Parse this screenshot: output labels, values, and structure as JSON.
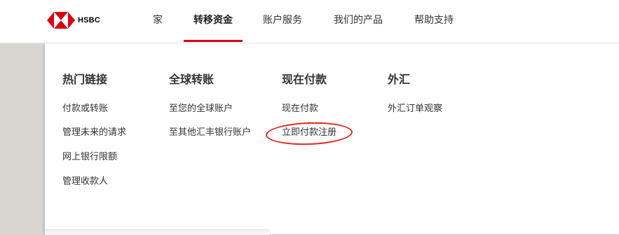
{
  "brand": {
    "name": "HSBC",
    "logo_icon": "hsbc-hexagon-logo",
    "accent": "#db0011"
  },
  "nav": {
    "items": [
      {
        "label": "家"
      },
      {
        "label": "转移资金",
        "active": true
      },
      {
        "label": "账户服务"
      },
      {
        "label": "我们的产品"
      },
      {
        "label": "帮助支持"
      }
    ]
  },
  "menu": {
    "columns": [
      {
        "heading": "热门链接",
        "links": [
          "付款或转账",
          "管理未来的请求",
          "网上银行限额",
          "管理收款人"
        ]
      },
      {
        "heading": "全球转账",
        "links": [
          "至您的全球账户",
          "至其他汇丰银行账户"
        ]
      },
      {
        "heading": "现在付款",
        "links": [
          "现在付款",
          "立即付款注册"
        ]
      },
      {
        "heading": "外汇",
        "links": [
          "外汇订单观察"
        ]
      }
    ],
    "highlighted_link": "立即付款注册",
    "highlight_color": "#e3261b"
  }
}
